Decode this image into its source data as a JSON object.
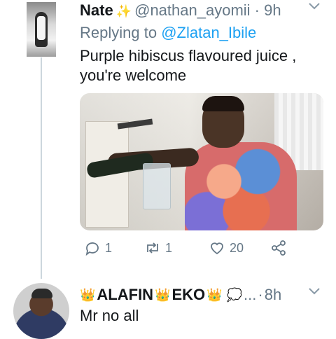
{
  "tweet": {
    "name": "Nate",
    "name_emoji_icon": "sparkles-icon",
    "handle": "@nathan_ayomii",
    "separator": "·",
    "time": "9h",
    "replying_label": "Replying to",
    "replying_to": "@Zlatan_Ibile",
    "text_line1": "Purple hibiscus flavoured juice ,",
    "text_line2": "you're welcome",
    "actions": {
      "reply_count": "1",
      "retweet_count": "1",
      "like_count": "20"
    }
  },
  "reply": {
    "name_part1": "ALAFIN",
    "name_part2": "EKO",
    "ellipsis": "...",
    "separator": "·",
    "time": "8h",
    "text": "Mr no all"
  },
  "colors": {
    "primary_text": "#14171a",
    "secondary_text": "#657786",
    "link": "#1da1f2",
    "thread_line": "#ccd6dd"
  }
}
